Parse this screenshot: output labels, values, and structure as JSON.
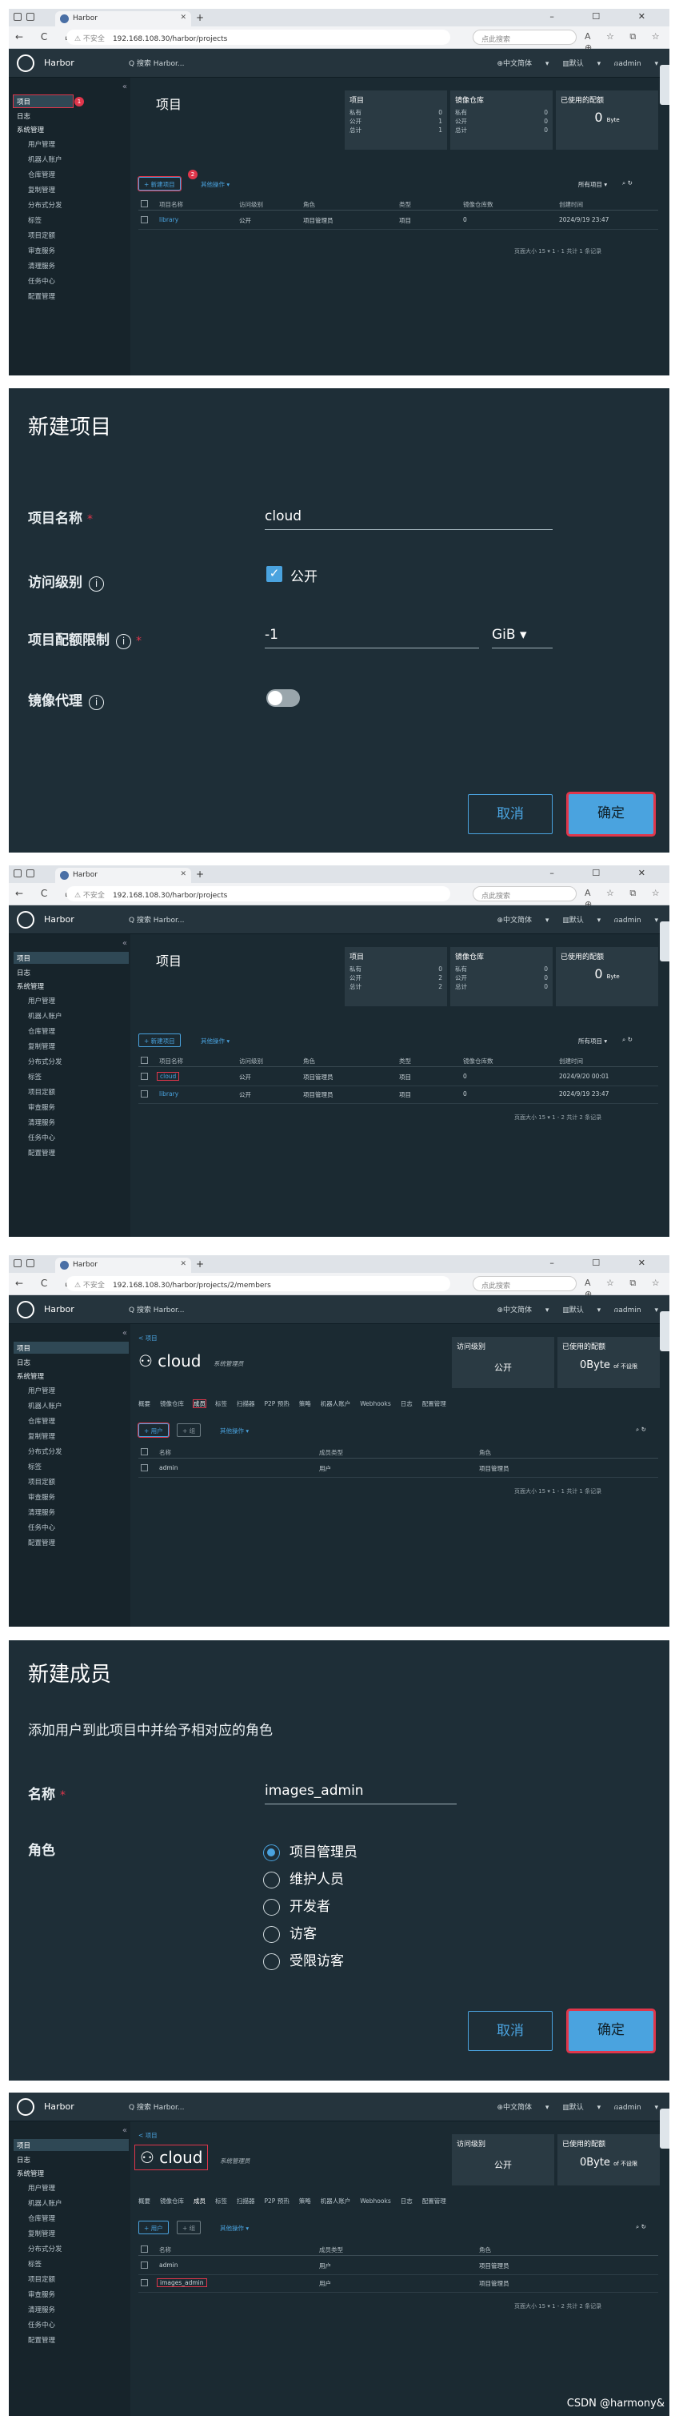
{
  "browser": {
    "tab_title": "Harbor",
    "new_tab": "+",
    "win_controls": "–  ☐  ✕",
    "nav": "←  C  ⌂",
    "not_secure": "⚠ 不安全",
    "url1": "192.168.108.30/harbor/projects",
    "url2": "192.168.108.30/harbor/projects/2/members",
    "search_placeholder": "点此搜索",
    "bar_icons": "A ☆ ⧉ ☆ ⊕ …"
  },
  "header": {
    "brand": "Harbor",
    "search": "Q 搜索 Harbor...",
    "right": "⊕中文简体 ▾  ▥默认 ▾  ⍝admin ▾"
  },
  "sidebar": {
    "items": [
      "项目",
      "日志",
      "系统管理"
    ],
    "sub": [
      "用户管理",
      "机器人账户",
      "仓库管理",
      "复制管理",
      "分布式分发",
      "标签",
      "项目定额",
      "审查服务",
      "清理服务",
      "任务中心",
      "配置管理"
    ],
    "collapse": "«"
  },
  "projects": {
    "title": "项目",
    "new_btn": "+ 新建项目",
    "action": "其他操作 ▾",
    "all_projects": "所有项目 ▾",
    "card1": {
      "title": "项目",
      "rows": [
        [
          "私有",
          "0"
        ],
        [
          "公开",
          "1"
        ],
        [
          "总计",
          "1"
        ]
      ]
    },
    "card1b": {
      "rows": [
        [
          "私有",
          "0"
        ],
        [
          "公开",
          "2"
        ],
        [
          "总计",
          "2"
        ]
      ]
    },
    "card2": {
      "title": "镜像仓库",
      "rows": [
        [
          "私有",
          "0"
        ],
        [
          "公开",
          "0"
        ],
        [
          "总计",
          "0"
        ]
      ]
    },
    "card3": {
      "title": "已使用的配额",
      "value": "0",
      "unit": "Byte"
    },
    "headers": [
      "项目名称",
      "访问级别",
      "角色",
      "类型",
      "镜像仓库数",
      "创建时间"
    ],
    "row_library": [
      "library",
      "公开",
      "项目管理员",
      "项目",
      "0",
      "2024/9/19 23:47"
    ],
    "row_cloud": [
      "cloud",
      "公开",
      "项目管理员",
      "项目",
      "0",
      "2024/9/20 00:01"
    ],
    "footer1": "页面大小  15 ▾   1 - 1 共计 1 条记录",
    "footer2": "页面大小  15 ▾   1 - 2 共计 2 条记录"
  },
  "new_project": {
    "title": "新建项目",
    "name_label": "项目名称",
    "name_value": "cloud",
    "access_label": "访问级别",
    "public": "公开",
    "quota_label": "项目配额限制",
    "quota_value": "-1",
    "quota_unit": "GiB ▾",
    "proxy_label": "镜像代理",
    "cancel": "取消",
    "ok": "确定"
  },
  "members": {
    "back": "< 项目",
    "project": "cloud",
    "role": "系统管理员",
    "access_title": "访问级别",
    "access_value": "公开",
    "quota_title": "已使用的配额",
    "quota_value": "0Byte",
    "quota_of": "of 不设限",
    "tabs": [
      "概要",
      "镜像仓库",
      "成员",
      "标签",
      "扫描器",
      "P2P 预热",
      "策略",
      "机器人账户",
      "Webhooks",
      "日志",
      "配置管理"
    ],
    "add_user": "+ 用户",
    "add_group": "+ 组",
    "more": "其他操作 ▾",
    "headers": [
      "名称",
      "成员类型",
      "角色"
    ],
    "row_admin": [
      "admin",
      "用户",
      "项目管理员"
    ],
    "row_images": [
      "images_admin",
      "用户",
      "项目管理员"
    ],
    "footer1": "页面大小  15 ▾   1 - 1 共计 1 条记录",
    "footer2": "页面大小  15 ▾   1 - 2 共计 2 条记录"
  },
  "new_member": {
    "title": "新建成员",
    "subtitle": "添加用户到此项目中并给予相对应的角色",
    "name_label": "名称",
    "name_value": "images_admin",
    "role_label": "角色",
    "roles": [
      "项目管理员",
      "维护人员",
      "开发者",
      "访客",
      "受限访客"
    ],
    "cancel": "取消",
    "ok": "确定"
  },
  "badges": [
    "1",
    "2"
  ],
  "watermark": "CSDN @harmony&"
}
